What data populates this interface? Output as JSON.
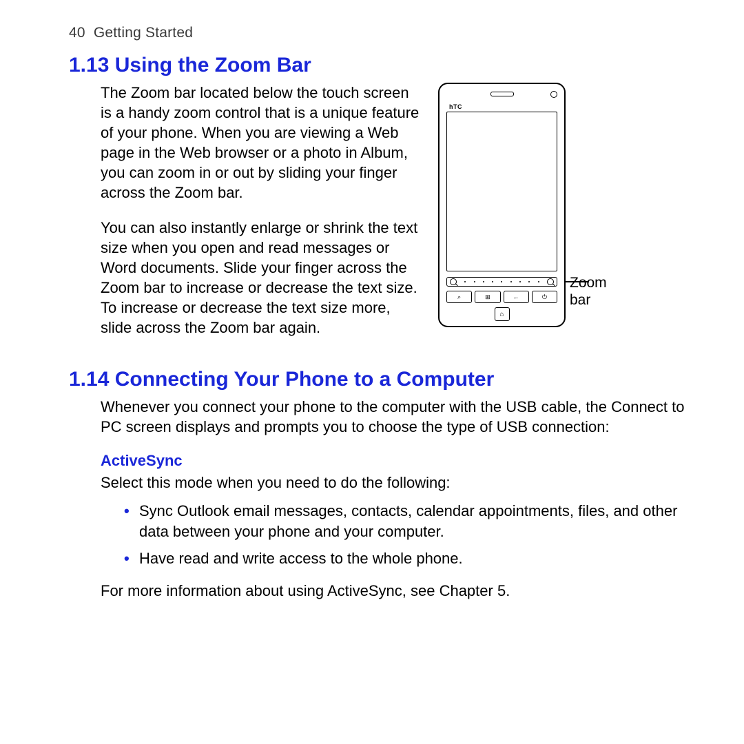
{
  "header": {
    "page_number": "40",
    "chapter_title": "Getting Started"
  },
  "section1": {
    "heading": "1.13  Using the Zoom Bar",
    "para1": "The Zoom bar located below the touch screen is a handy zoom control that is a unique feature of your phone. When you are viewing a Web page in the Web browser or a photo in Album, you can zoom in or out by sliding your finger across the Zoom bar.",
    "para2": "You can also instantly enlarge or shrink the text size when you open and read messages or Word documents. Slide your finger across the Zoom bar to increase or decrease the text size. To increase or decrease the text size more, slide across the Zoom bar again.",
    "illustration": {
      "brand": "hTC",
      "callout_label": "Zoom bar"
    }
  },
  "section2": {
    "heading": "1.14  Connecting Your Phone to a Computer",
    "intro": "Whenever you connect your phone to the computer with the USB cable, the Connect to PC screen displays and prompts you to choose the type of USB connection:",
    "mode1": {
      "title": "ActiveSync",
      "lead": "Select this mode when you need to do the following:",
      "bullets": [
        "Sync Outlook email messages, contacts, calendar appointments, files, and other data between your phone and your computer.",
        "Have read and write access to the whole phone."
      ],
      "footer": "For more information about using ActiveSync, see Chapter 5."
    }
  }
}
